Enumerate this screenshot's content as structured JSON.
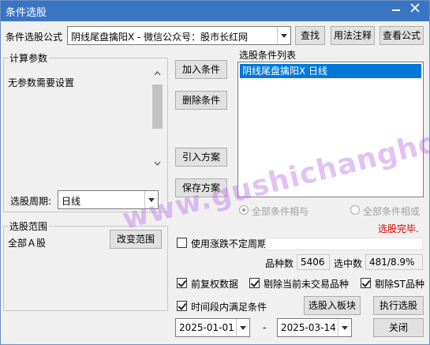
{
  "window": {
    "title": "条件选股",
    "minimize_icon": "minimize-icon",
    "close_icon": "close-icon"
  },
  "formula": {
    "label": "条件选股公式",
    "value": "阴线尾盘擒阳X  -  微信公众号：股市长红网",
    "find_button": "查找",
    "usage_button": "用法注释",
    "view_button": "查看公式"
  },
  "params": {
    "group_title": "计算参数",
    "text": "无参数需要设置",
    "period_label": "选股周期:",
    "period_value": "日线"
  },
  "actions": {
    "add_condition": "加入条件",
    "delete_condition": "删除条件",
    "import_plan": "引入方案",
    "save_plan": "保存方案"
  },
  "condition_list": {
    "title": "选股条件列表",
    "items": [
      "阴线尾盘擒阳X  日线"
    ],
    "all_and": "全部条件相与",
    "all_or": "全部条件相或",
    "selected_logic": "全部条件相与"
  },
  "status": {
    "text": "选股完毕.",
    "color": "#e00000"
  },
  "range": {
    "group_title": "选股范围",
    "value": "全部Ａ股",
    "change_button": "改变范围"
  },
  "options": {
    "use_uncertain_period": {
      "label": "使用涨跌不定周期",
      "checked": false
    },
    "forward_adjust": {
      "label": "前复权数据",
      "checked": true
    },
    "exclude_untraded": {
      "label": "剔除当前未交易品种",
      "checked": true
    },
    "exclude_st": {
      "label": "剔除ST品种",
      "checked": true
    },
    "time_range_meet": {
      "label": "时间段内满足条件",
      "checked": true
    }
  },
  "stats": {
    "count_label": "品种数",
    "count_value": "5406",
    "hit_label": "选中数",
    "hit_value": "481/8.9%"
  },
  "dates": {
    "start": "2025-01-01",
    "separator": "-",
    "end": "2025-03-14"
  },
  "bottom_buttons": {
    "to_block": "选股入板块",
    "execute": "执行选股",
    "close": "关闭"
  },
  "watermark": {
    "text": "www.gushichanghong.com"
  },
  "colors": {
    "title_bar": "#3a75c4",
    "list_selection": "#0078d7",
    "status": "#e00000"
  }
}
